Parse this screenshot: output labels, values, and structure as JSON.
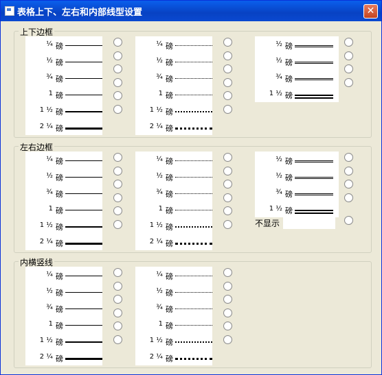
{
  "window": {
    "title": "表格上下、左右和内部线型设置",
    "close_symbol": "✕"
  },
  "unit": "磅",
  "weights": [
    "¼",
    "½",
    "¾",
    "1",
    "1 ½",
    "2 ¼"
  ],
  "weights_double": [
    "½",
    "½",
    "¾",
    "1 ½"
  ],
  "groups": {
    "top_bottom": {
      "label": "上下边框"
    },
    "left_right": {
      "label": "左右边框",
      "none_label": "不显示"
    },
    "inner": {
      "label": "内横竖线"
    }
  }
}
